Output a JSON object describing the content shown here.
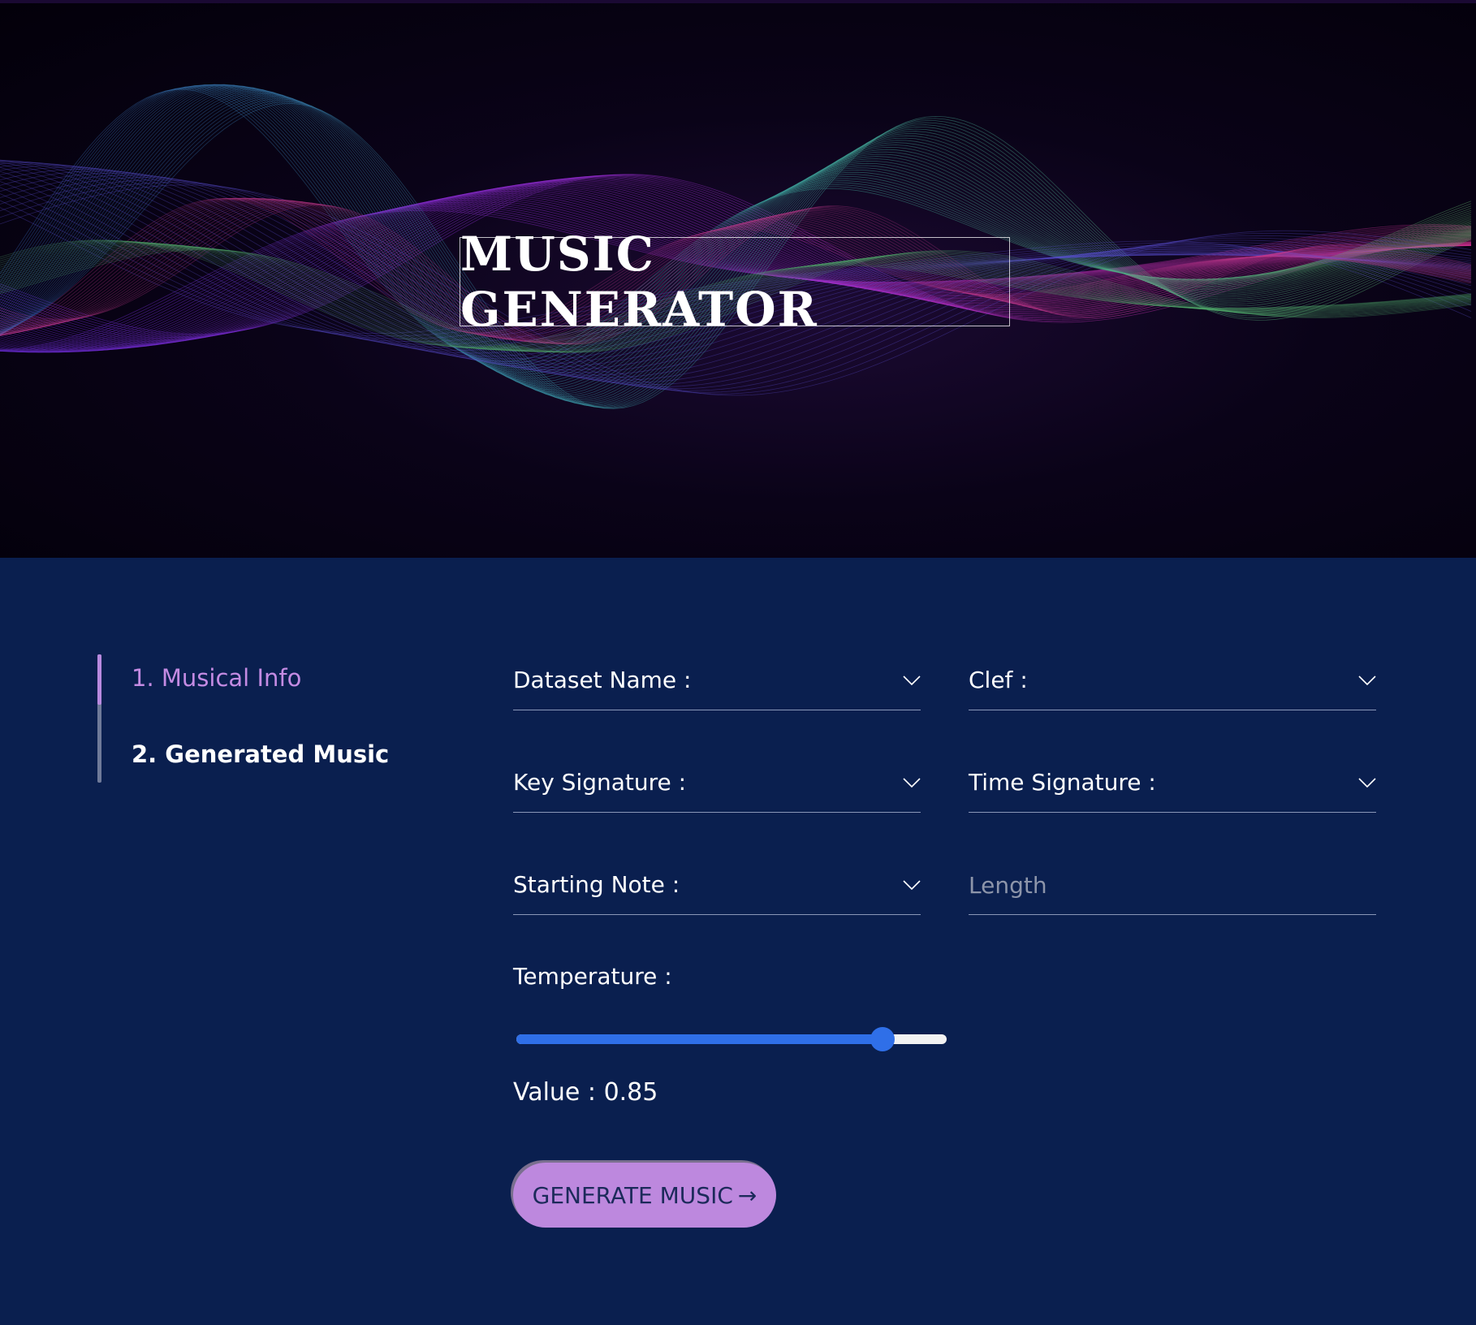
{
  "hero": {
    "title": "MUSIC GENERATOR"
  },
  "steps": [
    {
      "label": "1. Musical Info",
      "active": true
    },
    {
      "label": "2. Generated Music",
      "active": false
    }
  ],
  "form": {
    "dataset_name_label": "Dataset Name :",
    "clef_label": "Clef :",
    "key_signature_label": "Key Signature :",
    "time_signature_label": "Time Signature :",
    "starting_note_label": "Starting Note :",
    "length_placeholder": "Length",
    "temperature_label": "Temperature :",
    "temperature_value": 0.85,
    "value_text": "Value : 0.85",
    "generate_label": "GENERATE MUSIC",
    "generate_icon": "arrow-right-icon"
  },
  "colors": {
    "background": "#0a1f4f",
    "accent": "#bd88de",
    "slider": "#2f6fe8",
    "active_step": "#c48be3"
  }
}
